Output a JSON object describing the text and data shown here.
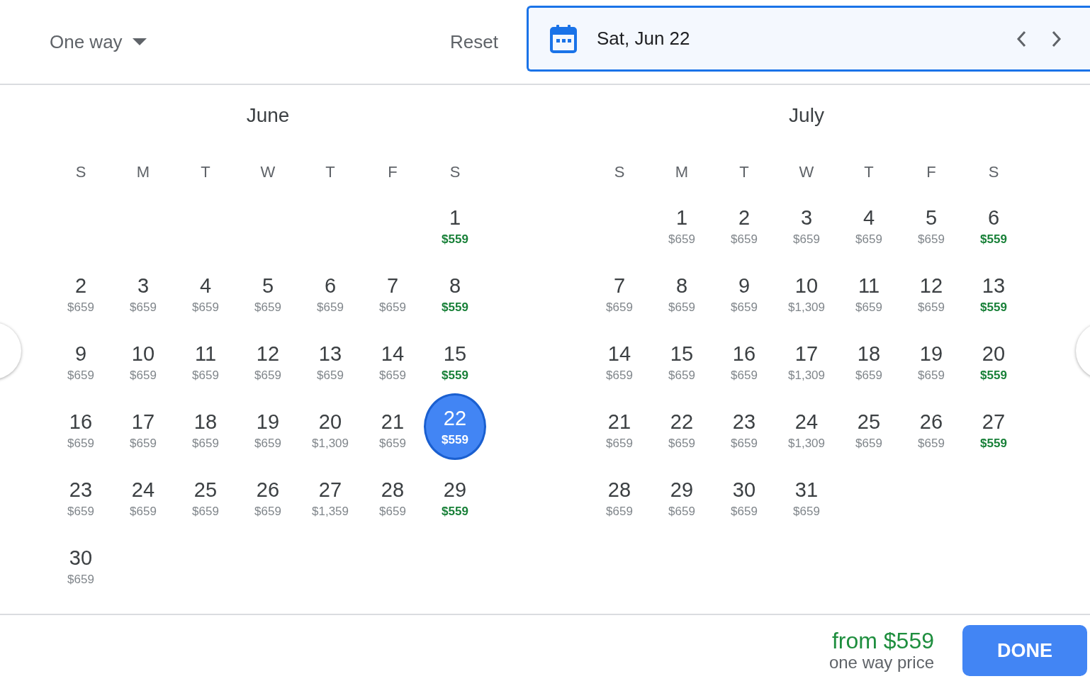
{
  "trip_type": {
    "label": "One way"
  },
  "reset": {
    "label": "Reset"
  },
  "date_field": {
    "value": "Sat, Jun 22"
  },
  "months": [
    {
      "title": "June",
      "weekdays": [
        "S",
        "M",
        "T",
        "W",
        "T",
        "F",
        "S"
      ],
      "days": [
        {
          "kind": "blank"
        },
        {
          "kind": "blank"
        },
        {
          "kind": "blank"
        },
        {
          "kind": "blank"
        },
        {
          "kind": "blank"
        },
        {
          "kind": "blank"
        },
        {
          "kind": "day",
          "day": "1",
          "price": "$559",
          "cheapest": true,
          "selected": false
        },
        {
          "kind": "day",
          "day": "2",
          "price": "$659",
          "cheapest": false,
          "selected": false
        },
        {
          "kind": "day",
          "day": "3",
          "price": "$659",
          "cheapest": false,
          "selected": false
        },
        {
          "kind": "day",
          "day": "4",
          "price": "$659",
          "cheapest": false,
          "selected": false
        },
        {
          "kind": "day",
          "day": "5",
          "price": "$659",
          "cheapest": false,
          "selected": false
        },
        {
          "kind": "day",
          "day": "6",
          "price": "$659",
          "cheapest": false,
          "selected": false
        },
        {
          "kind": "day",
          "day": "7",
          "price": "$659",
          "cheapest": false,
          "selected": false
        },
        {
          "kind": "day",
          "day": "8",
          "price": "$559",
          "cheapest": true,
          "selected": false
        },
        {
          "kind": "day",
          "day": "9",
          "price": "$659",
          "cheapest": false,
          "selected": false
        },
        {
          "kind": "day",
          "day": "10",
          "price": "$659",
          "cheapest": false,
          "selected": false
        },
        {
          "kind": "day",
          "day": "11",
          "price": "$659",
          "cheapest": false,
          "selected": false
        },
        {
          "kind": "day",
          "day": "12",
          "price": "$659",
          "cheapest": false,
          "selected": false
        },
        {
          "kind": "day",
          "day": "13",
          "price": "$659",
          "cheapest": false,
          "selected": false
        },
        {
          "kind": "day",
          "day": "14",
          "price": "$659",
          "cheapest": false,
          "selected": false
        },
        {
          "kind": "day",
          "day": "15",
          "price": "$559",
          "cheapest": true,
          "selected": false
        },
        {
          "kind": "day",
          "day": "16",
          "price": "$659",
          "cheapest": false,
          "selected": false
        },
        {
          "kind": "day",
          "day": "17",
          "price": "$659",
          "cheapest": false,
          "selected": false
        },
        {
          "kind": "day",
          "day": "18",
          "price": "$659",
          "cheapest": false,
          "selected": false
        },
        {
          "kind": "day",
          "day": "19",
          "price": "$659",
          "cheapest": false,
          "selected": false
        },
        {
          "kind": "day",
          "day": "20",
          "price": "$1,309",
          "cheapest": false,
          "selected": false
        },
        {
          "kind": "day",
          "day": "21",
          "price": "$659",
          "cheapest": false,
          "selected": false
        },
        {
          "kind": "day",
          "day": "22",
          "price": "$559",
          "cheapest": true,
          "selected": true
        },
        {
          "kind": "day",
          "day": "23",
          "price": "$659",
          "cheapest": false,
          "selected": false
        },
        {
          "kind": "day",
          "day": "24",
          "price": "$659",
          "cheapest": false,
          "selected": false
        },
        {
          "kind": "day",
          "day": "25",
          "price": "$659",
          "cheapest": false,
          "selected": false
        },
        {
          "kind": "day",
          "day": "26",
          "price": "$659",
          "cheapest": false,
          "selected": false
        },
        {
          "kind": "day",
          "day": "27",
          "price": "$1,359",
          "cheapest": false,
          "selected": false
        },
        {
          "kind": "day",
          "day": "28",
          "price": "$659",
          "cheapest": false,
          "selected": false
        },
        {
          "kind": "day",
          "day": "29",
          "price": "$559",
          "cheapest": true,
          "selected": false
        },
        {
          "kind": "day",
          "day": "30",
          "price": "$659",
          "cheapest": false,
          "selected": false
        }
      ]
    },
    {
      "title": "July",
      "weekdays": [
        "S",
        "M",
        "T",
        "W",
        "T",
        "F",
        "S"
      ],
      "days": [
        {
          "kind": "blank"
        },
        {
          "kind": "day",
          "day": "1",
          "price": "$659",
          "cheapest": false,
          "selected": false
        },
        {
          "kind": "day",
          "day": "2",
          "price": "$659",
          "cheapest": false,
          "selected": false
        },
        {
          "kind": "day",
          "day": "3",
          "price": "$659",
          "cheapest": false,
          "selected": false
        },
        {
          "kind": "day",
          "day": "4",
          "price": "$659",
          "cheapest": false,
          "selected": false
        },
        {
          "kind": "day",
          "day": "5",
          "price": "$659",
          "cheapest": false,
          "selected": false
        },
        {
          "kind": "day",
          "day": "6",
          "price": "$559",
          "cheapest": true,
          "selected": false
        },
        {
          "kind": "day",
          "day": "7",
          "price": "$659",
          "cheapest": false,
          "selected": false
        },
        {
          "kind": "day",
          "day": "8",
          "price": "$659",
          "cheapest": false,
          "selected": false
        },
        {
          "kind": "day",
          "day": "9",
          "price": "$659",
          "cheapest": false,
          "selected": false
        },
        {
          "kind": "day",
          "day": "10",
          "price": "$1,309",
          "cheapest": false,
          "selected": false
        },
        {
          "kind": "day",
          "day": "11",
          "price": "$659",
          "cheapest": false,
          "selected": false
        },
        {
          "kind": "day",
          "day": "12",
          "price": "$659",
          "cheapest": false,
          "selected": false
        },
        {
          "kind": "day",
          "day": "13",
          "price": "$559",
          "cheapest": true,
          "selected": false
        },
        {
          "kind": "day",
          "day": "14",
          "price": "$659",
          "cheapest": false,
          "selected": false
        },
        {
          "kind": "day",
          "day": "15",
          "price": "$659",
          "cheapest": false,
          "selected": false
        },
        {
          "kind": "day",
          "day": "16",
          "price": "$659",
          "cheapest": false,
          "selected": false
        },
        {
          "kind": "day",
          "day": "17",
          "price": "$1,309",
          "cheapest": false,
          "selected": false
        },
        {
          "kind": "day",
          "day": "18",
          "price": "$659",
          "cheapest": false,
          "selected": false
        },
        {
          "kind": "day",
          "day": "19",
          "price": "$659",
          "cheapest": false,
          "selected": false
        },
        {
          "kind": "day",
          "day": "20",
          "price": "$559",
          "cheapest": true,
          "selected": false
        },
        {
          "kind": "day",
          "day": "21",
          "price": "$659",
          "cheapest": false,
          "selected": false
        },
        {
          "kind": "day",
          "day": "22",
          "price": "$659",
          "cheapest": false,
          "selected": false
        },
        {
          "kind": "day",
          "day": "23",
          "price": "$659",
          "cheapest": false,
          "selected": false
        },
        {
          "kind": "day",
          "day": "24",
          "price": "$1,309",
          "cheapest": false,
          "selected": false
        },
        {
          "kind": "day",
          "day": "25",
          "price": "$659",
          "cheapest": false,
          "selected": false
        },
        {
          "kind": "day",
          "day": "26",
          "price": "$659",
          "cheapest": false,
          "selected": false
        },
        {
          "kind": "day",
          "day": "27",
          "price": "$559",
          "cheapest": true,
          "selected": false
        },
        {
          "kind": "day",
          "day": "28",
          "price": "$659",
          "cheapest": false,
          "selected": false
        },
        {
          "kind": "day",
          "day": "29",
          "price": "$659",
          "cheapest": false,
          "selected": false
        },
        {
          "kind": "day",
          "day": "30",
          "price": "$659",
          "cheapest": false,
          "selected": false
        },
        {
          "kind": "day",
          "day": "31",
          "price": "$659",
          "cheapest": false,
          "selected": false
        }
      ]
    }
  ],
  "footer": {
    "price": "from $559",
    "caption": "one way price",
    "done": "DONE"
  }
}
